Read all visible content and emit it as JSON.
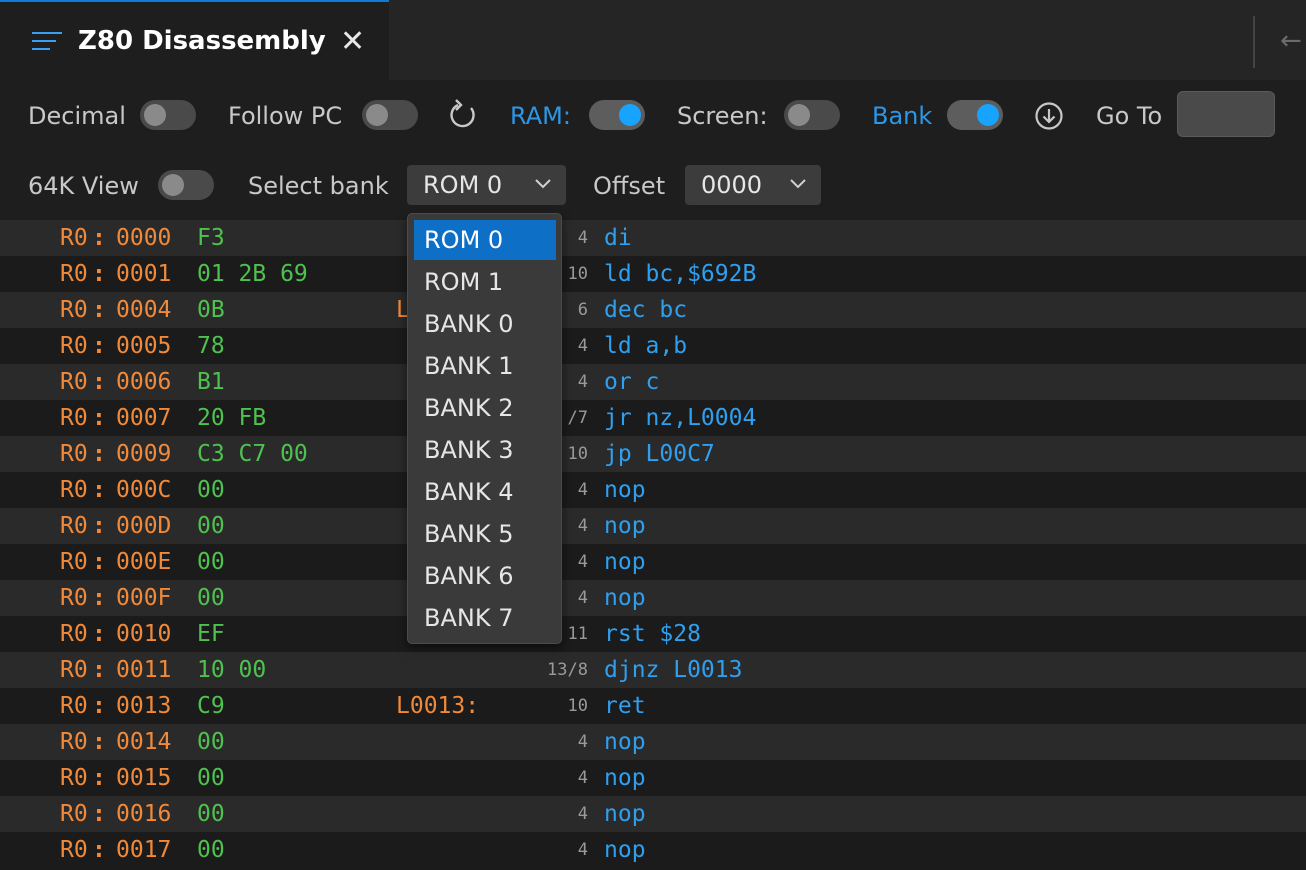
{
  "tab": {
    "title": "Z80 Disassembly",
    "close": "✕",
    "back": "←"
  },
  "toolbar": {
    "decimal_label": "Decimal",
    "follow_pc_label": "Follow PC",
    "ram_label": "RAM:",
    "screen_label": "Screen:",
    "bank_label": "Bank",
    "goto_label": "Go To",
    "goto_value": "",
    "view64k_label": "64K View",
    "select_bank_label": "Select bank",
    "select_bank_value": "ROM 0",
    "offset_label": "Offset",
    "offset_value": "0000",
    "toggles": {
      "decimal": false,
      "follow_pc": false,
      "ram": true,
      "screen": false,
      "bank": true,
      "view64k": false
    }
  },
  "dropdown": {
    "options": [
      "ROM 0",
      "ROM 1",
      "BANK 0",
      "BANK 1",
      "BANK 2",
      "BANK 3",
      "BANK 4",
      "BANK 5",
      "BANK 6",
      "BANK 7"
    ],
    "selected": "ROM 0"
  },
  "listing": [
    {
      "bank": "R0",
      "sep": ":",
      "addr": "0000",
      "bytes": "F3",
      "label": "",
      "cycles": "4",
      "instr": "di"
    },
    {
      "bank": "R0",
      "sep": ":",
      "addr": "0001",
      "bytes": "01 2B 69",
      "label": "",
      "cycles": "10",
      "instr": "ld bc,$692B"
    },
    {
      "bank": "R0",
      "sep": ":",
      "addr": "0004",
      "bytes": "0B",
      "label": "L",
      "cycles": "6",
      "instr": "dec bc"
    },
    {
      "bank": "R0",
      "sep": ":",
      "addr": "0005",
      "bytes": "78",
      "label": "",
      "cycles": "4",
      "instr": "ld a,b"
    },
    {
      "bank": "R0",
      "sep": ":",
      "addr": "0006",
      "bytes": "B1",
      "label": "",
      "cycles": "4",
      "instr": "or c"
    },
    {
      "bank": "R0",
      "sep": ":",
      "addr": "0007",
      "bytes": "20 FB",
      "label": "",
      "cycles": "/7",
      "instr": "jr nz,L0004"
    },
    {
      "bank": "R0",
      "sep": ":",
      "addr": "0009",
      "bytes": "C3 C7 00",
      "label": "",
      "cycles": "10",
      "instr": "jp L00C7"
    },
    {
      "bank": "R0",
      "sep": ":",
      "addr": "000C",
      "bytes": "00",
      "label": "",
      "cycles": "4",
      "instr": "nop"
    },
    {
      "bank": "R0",
      "sep": ":",
      "addr": "000D",
      "bytes": "00",
      "label": "",
      "cycles": "4",
      "instr": "nop"
    },
    {
      "bank": "R0",
      "sep": ":",
      "addr": "000E",
      "bytes": "00",
      "label": "",
      "cycles": "4",
      "instr": "nop"
    },
    {
      "bank": "R0",
      "sep": ":",
      "addr": "000F",
      "bytes": "00",
      "label": "",
      "cycles": "4",
      "instr": "nop"
    },
    {
      "bank": "R0",
      "sep": ":",
      "addr": "0010",
      "bytes": "EF",
      "label": "",
      "cycles": "11",
      "instr": "rst $28"
    },
    {
      "bank": "R0",
      "sep": ":",
      "addr": "0011",
      "bytes": "10 00",
      "label": "",
      "cycles": "13/8",
      "instr": "djnz L0013"
    },
    {
      "bank": "R0",
      "sep": ":",
      "addr": "0013",
      "bytes": "C9",
      "label": "L0013:",
      "cycles": "10",
      "instr": "ret"
    },
    {
      "bank": "R0",
      "sep": ":",
      "addr": "0014",
      "bytes": "00",
      "label": "",
      "cycles": "4",
      "instr": "nop"
    },
    {
      "bank": "R0",
      "sep": ":",
      "addr": "0015",
      "bytes": "00",
      "label": "",
      "cycles": "4",
      "instr": "nop"
    },
    {
      "bank": "R0",
      "sep": ":",
      "addr": "0016",
      "bytes": "00",
      "label": "",
      "cycles": "4",
      "instr": "nop"
    },
    {
      "bank": "R0",
      "sep": ":",
      "addr": "0017",
      "bytes": "00",
      "label": "",
      "cycles": "4",
      "instr": "nop"
    }
  ]
}
